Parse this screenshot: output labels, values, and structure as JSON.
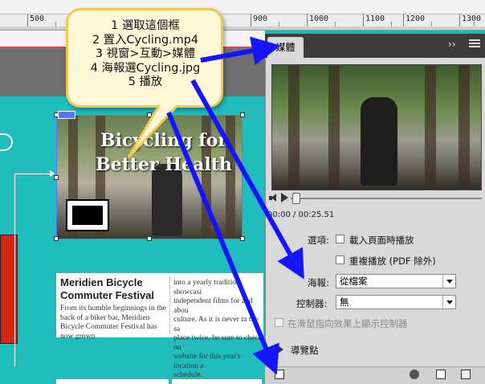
{
  "ruler": {
    "marks": [
      "500",
      "900",
      "1000",
      "1100",
      "1200",
      "1300"
    ]
  },
  "callout": {
    "steps": [
      "1 選取這個框",
      "2 置入Cycling.mp4",
      "3 視窗>互動>媒體",
      "4 海報選Cycling.jpg",
      "5 播放"
    ]
  },
  "page": {
    "headline": [
      "Bicycling for",
      "Better Health"
    ],
    "article_title": "Meridien Bicycle Commuter Festival",
    "article_body_left": "From its humble beginnings in the back of a biker bar, Meridien Bicycle Commuter Festival has now grown",
    "article_body_right": "into a yearly tradition showcasi\nindependent films for and abou\nculture. As it is never in the sa\nplace twice, be sure to check ou\nwebsite for this year's location a\nschedule."
  },
  "panel": {
    "tab": "媒體",
    "collapse": "››",
    "timecode": "00:00 / 00:25.51",
    "options_label": "選項:",
    "option_autoplay": "載入頁面時播放",
    "option_loop": "重複播放 (PDF 除外)",
    "poster_label": "海報:",
    "poster_value": "從檔案",
    "controller_label": "控制器:",
    "controller_value": "無",
    "rollover_label": "在滑鼠指向效果上顯示控制器",
    "nav_points": "導覽點"
  },
  "colors": {
    "arrow": "#1414ff",
    "teal": "#21bdbd",
    "callout_border": "#f2c94c"
  }
}
